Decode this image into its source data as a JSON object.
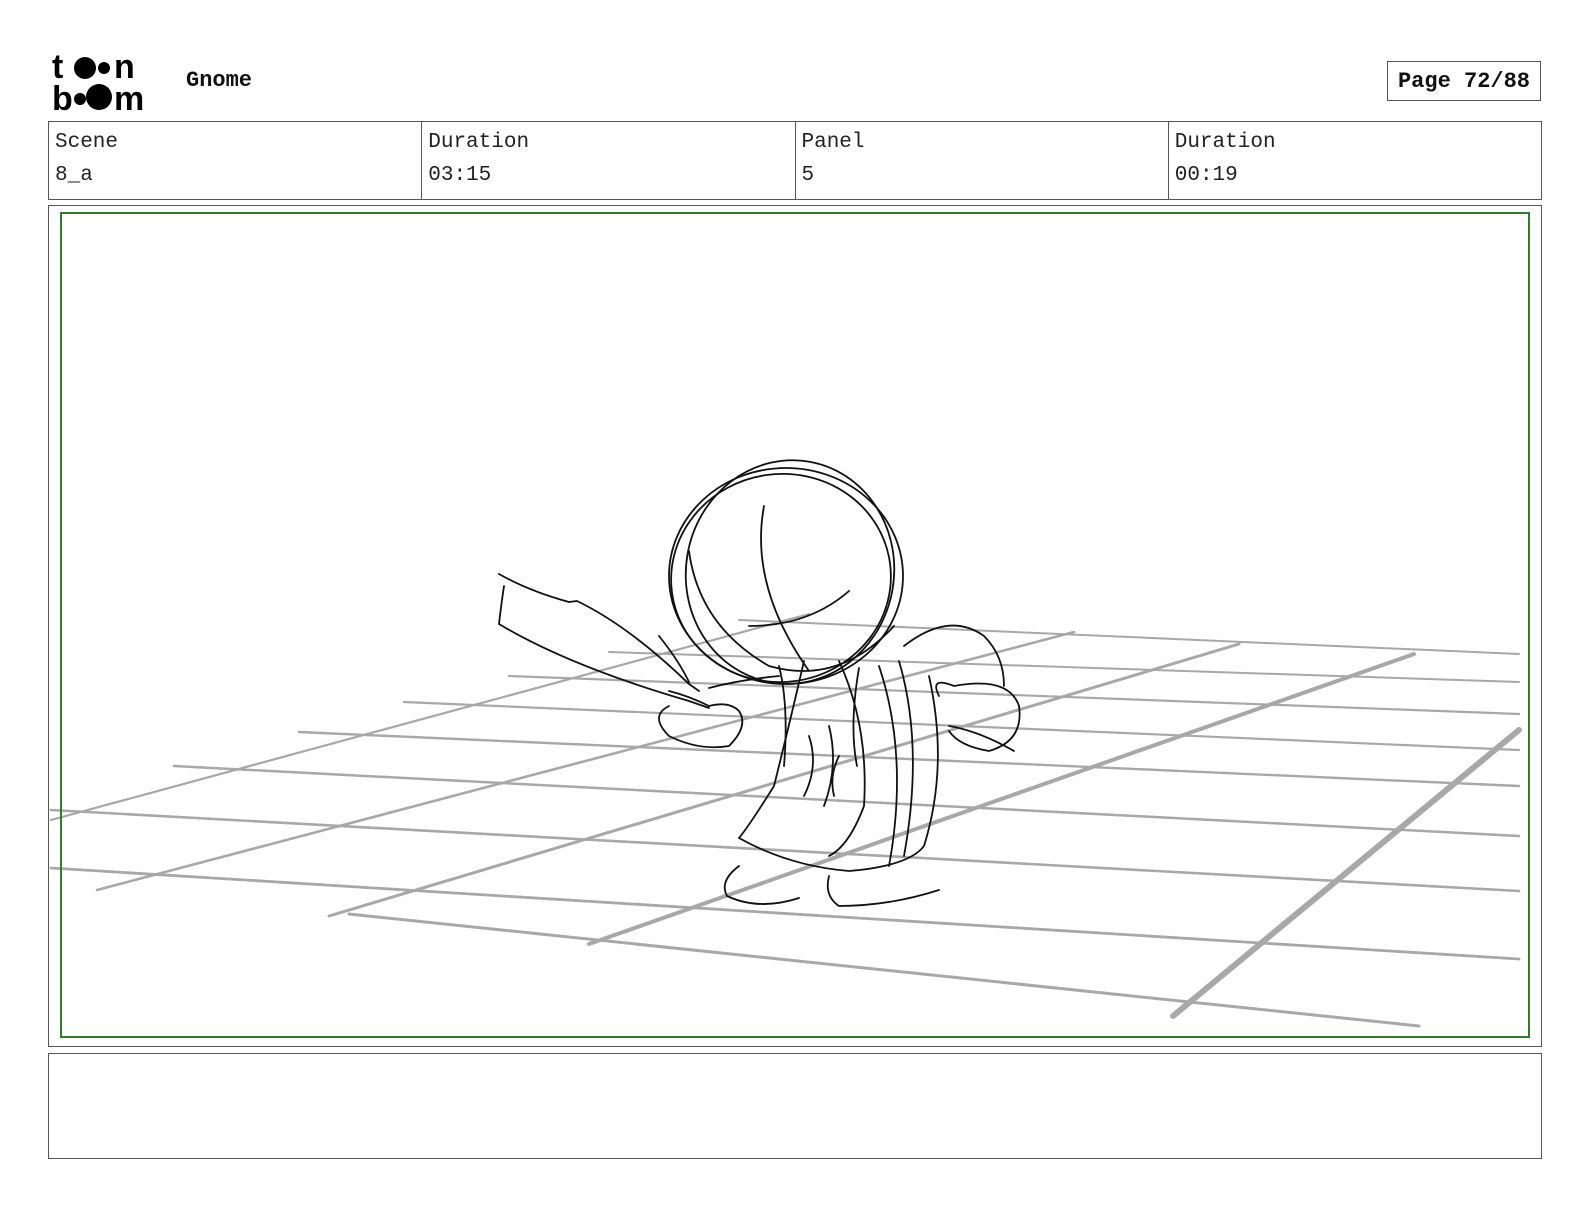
{
  "header": {
    "logo_name": "toonboom-logo",
    "project_title": "Gnome",
    "page_label": "Page 72/88"
  },
  "info": {
    "scene_label": "Scene",
    "scene_value": "8_a",
    "scene_duration_label": "Duration",
    "scene_duration_value": "03:15",
    "panel_label": "Panel",
    "panel_value": "5",
    "panel_duration_label": "Duration",
    "panel_duration_value": "00:19"
  },
  "panel": {
    "safe_frame_color": "#2e7d32",
    "grid_color": "#a8a8a8",
    "sketch_color": "#111111"
  },
  "caption": {
    "text": ""
  }
}
